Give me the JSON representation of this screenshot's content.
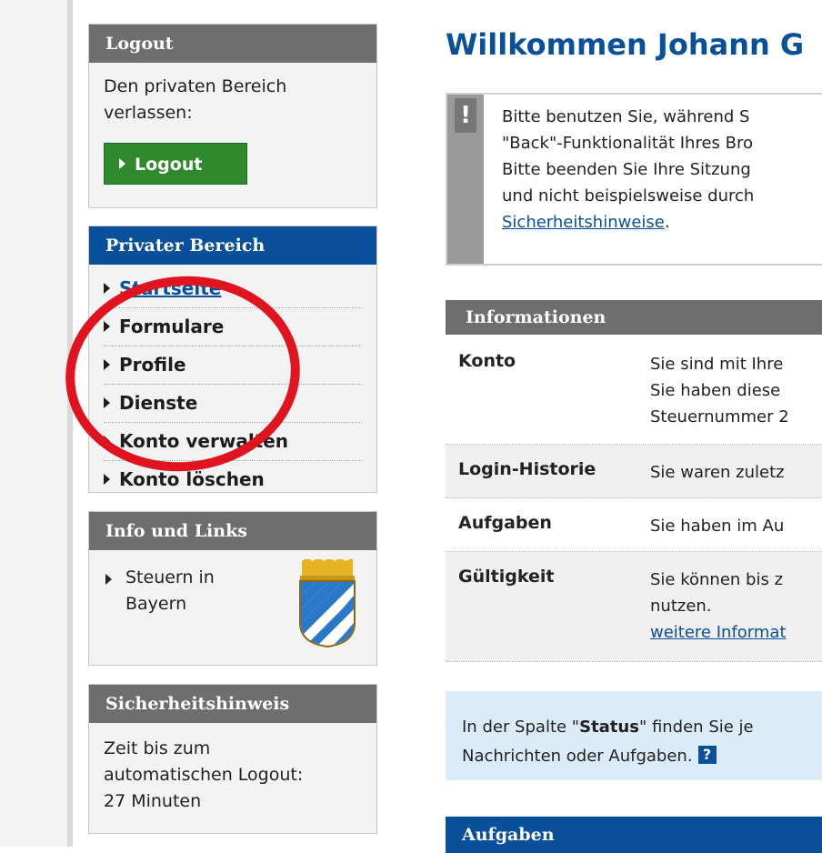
{
  "sidebar": {
    "logout_box": {
      "title": "Logout",
      "text_line1": "Den privaten Bereich",
      "text_line2": "verlassen:",
      "button_label": "Logout"
    },
    "private_box": {
      "title": "Privater Bereich",
      "items": [
        {
          "label": "Startseite"
        },
        {
          "label": "Formulare"
        },
        {
          "label": "Profile"
        },
        {
          "label": "Dienste"
        },
        {
          "label": "Konto verwalten"
        },
        {
          "label": "Konto löschen"
        }
      ]
    },
    "info_box": {
      "title": "Info und Links",
      "link_line1": "Steuern in",
      "link_line2": "Bayern"
    },
    "security_box": {
      "title": "Sicherheitshinweis",
      "line1": "Zeit bis zum",
      "line2": "automatischen Logout:",
      "line3": "27 Minuten"
    }
  },
  "main": {
    "title": "Willkommen Johann G",
    "notice": {
      "icon": "!",
      "line1": "Bitte benutzen Sie, während S",
      "line2": "\"Back\"-Funktionalität Ihres Bro",
      "line3": "Bitte beenden Sie Ihre Sitzung",
      "line4": "und nicht beispielsweise durch",
      "link": "Sicherheitshinweise",
      "link_suffix": "."
    },
    "info": {
      "title": "Informationen",
      "rows": [
        {
          "label": "Konto",
          "lines": [
            "Sie sind mit Ihre",
            "Sie haben diese",
            "Steuernummer 2"
          ]
        },
        {
          "label": "Login-Historie",
          "lines": [
            "Sie waren zuletz"
          ]
        },
        {
          "label": "Aufgaben",
          "lines": [
            "Sie haben im Au"
          ]
        },
        {
          "label": "Gültigkeit",
          "lines": [
            "Sie können bis z",
            "nutzen."
          ],
          "link": "weitere Informat"
        }
      ]
    },
    "status": {
      "pre": "In der Spalte \"",
      "bold": "Status",
      "post": "\" finden Sie je",
      "line2": "Nachrichten oder Aufgaben.",
      "help_icon": "?"
    },
    "aufgaben_title": "Aufgaben"
  },
  "colors": {
    "brand_blue": "#0a4f9a",
    "header_gray": "#6e6e6e",
    "logout_green": "#2e8a2c",
    "annotation_red": "#e0141e"
  }
}
